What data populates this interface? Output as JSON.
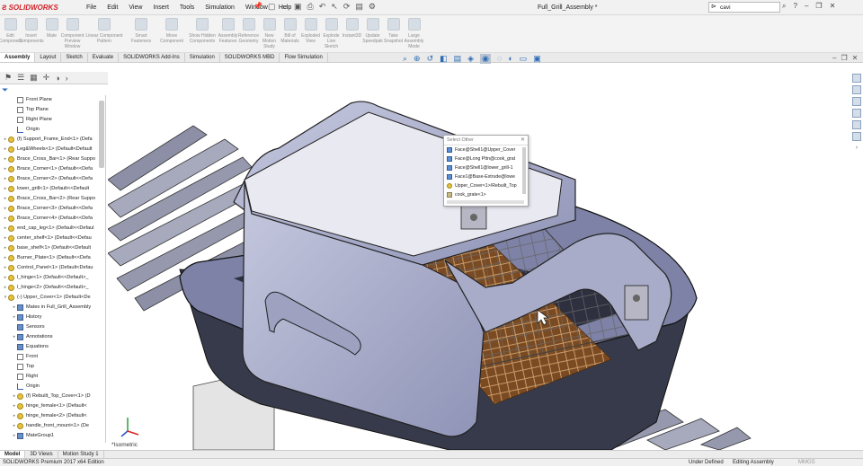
{
  "app": {
    "logo_text": "SOLIDWORKS",
    "document_title": "Full_Grill_Assembly *"
  },
  "menus": [
    "File",
    "Edit",
    "View",
    "Insert",
    "Tools",
    "Simulation",
    "Window",
    "Help"
  ],
  "search": {
    "value": "cavi"
  },
  "commands": [
    {
      "label": "Edit Component",
      "size": "normal"
    },
    {
      "label": "Insert Components",
      "size": "normal"
    },
    {
      "label": "Mate",
      "size": "normal"
    },
    {
      "label": "Component Preview Window",
      "size": "normal"
    },
    {
      "label": "Linear Component Pattern",
      "size": "wide"
    },
    {
      "label": "Smart Fasteners",
      "size": "med"
    },
    {
      "label": "Move Component",
      "size": "med"
    },
    {
      "label": "Show Hidden Components",
      "size": "med"
    },
    {
      "label": "Assembly Features",
      "size": "normal"
    },
    {
      "label": "Reference Geometry",
      "size": "normal"
    },
    {
      "label": "New Motion Study",
      "size": "normal"
    },
    {
      "label": "Bill of Materials",
      "size": "normal"
    },
    {
      "label": "Exploded View",
      "size": "normal"
    },
    {
      "label": "Explode Line Sketch",
      "size": "normal"
    },
    {
      "label": "Instant3D",
      "size": "normal"
    },
    {
      "label": "Update Speedpak",
      "size": "normal"
    },
    {
      "label": "Take Snapshot",
      "size": "normal"
    },
    {
      "label": "Large Assembly Mode",
      "size": "normal"
    }
  ],
  "tabs": [
    {
      "label": "Assembly",
      "active": true
    },
    {
      "label": "Layout",
      "active": false
    },
    {
      "label": "Sketch",
      "active": false
    },
    {
      "label": "Evaluate",
      "active": false
    },
    {
      "label": "SOLIDWORKS Add-Ins",
      "active": false
    },
    {
      "label": "Simulation",
      "active": false
    },
    {
      "label": "SOLIDWORKS MBD",
      "active": false
    },
    {
      "label": "Flow Simulation",
      "active": false
    }
  ],
  "tree": [
    {
      "label": "Front Plane",
      "icon": "plane",
      "indent": 1,
      "arrow": ""
    },
    {
      "label": "Top Plane",
      "icon": "plane",
      "indent": 1,
      "arrow": ""
    },
    {
      "label": "Right Plane",
      "icon": "plane",
      "indent": 1,
      "arrow": ""
    },
    {
      "label": "Origin",
      "icon": "origin",
      "indent": 1,
      "arrow": ""
    },
    {
      "label": "(f) Support_Frame_End<1> (Defa",
      "icon": "part",
      "indent": 0,
      "arrow": "▸"
    },
    {
      "label": "Leg&Wheels<1> (Default<Default",
      "icon": "part",
      "indent": 0,
      "arrow": "▸"
    },
    {
      "label": "Brace_Cross_Bar<1> (Rear Suppo",
      "icon": "part",
      "indent": 0,
      "arrow": "▸"
    },
    {
      "label": "Brace_Corner<1> (Default<<Defa",
      "icon": "part",
      "indent": 0,
      "arrow": "▸"
    },
    {
      "label": "Brace_Corner<2> (Default<<Defa",
      "icon": "part",
      "indent": 0,
      "arrow": "▸"
    },
    {
      "label": "lower_grill<1> (Default<<Default",
      "icon": "part",
      "indent": 0,
      "arrow": "▸"
    },
    {
      "label": "Brace_Cross_Bar<2> (Rear Suppo",
      "icon": "part",
      "indent": 0,
      "arrow": "▸"
    },
    {
      "label": "Brace_Corner<3> (Default<<Defa",
      "icon": "part",
      "indent": 0,
      "arrow": "▸"
    },
    {
      "label": "Brace_Corner<4> (Default<<Defa",
      "icon": "part",
      "indent": 0,
      "arrow": "▸"
    },
    {
      "label": "end_cap_leg<1> (Default<<Defaul",
      "icon": "part",
      "indent": 0,
      "arrow": "▸"
    },
    {
      "label": "center_shelf<1> (Default<<Defau",
      "icon": "part",
      "indent": 0,
      "arrow": "▸"
    },
    {
      "label": "base_shelf<1> (Default<<Default",
      "icon": "part",
      "indent": 0,
      "arrow": "▸"
    },
    {
      "label": "Burner_Plate<1> (Default<<Defa",
      "icon": "part",
      "indent": 0,
      "arrow": "▸"
    },
    {
      "label": "Control_Panel<1> (Default<Defau",
      "icon": "part",
      "indent": 0,
      "arrow": "▸"
    },
    {
      "label": "l_hinge<1> (Default<<Default>_",
      "icon": "part",
      "indent": 0,
      "arrow": "▸"
    },
    {
      "label": "l_hinge<2> (Default<<Default>_",
      "icon": "part",
      "indent": 0,
      "arrow": "▸"
    },
    {
      "label": "(-) Upper_Cover<1> (Default<De",
      "icon": "part",
      "indent": 0,
      "arrow": "▾"
    },
    {
      "label": "Mates in Full_Grill_Assembly",
      "icon": "folder",
      "indent": 1,
      "arrow": "▸"
    },
    {
      "label": "History",
      "icon": "folder",
      "indent": 1,
      "arrow": "▸"
    },
    {
      "label": "Sensors",
      "icon": "folder",
      "indent": 1,
      "arrow": ""
    },
    {
      "label": "Annotations",
      "icon": "folder",
      "indent": 1,
      "arrow": "▸"
    },
    {
      "label": "Equations",
      "icon": "folder",
      "indent": 1,
      "arrow": ""
    },
    {
      "label": "Front",
      "icon": "plane",
      "indent": 1,
      "arrow": ""
    },
    {
      "label": "Top",
      "icon": "plane",
      "indent": 1,
      "arrow": ""
    },
    {
      "label": "Right",
      "icon": "plane",
      "indent": 1,
      "arrow": ""
    },
    {
      "label": "Origin",
      "icon": "origin",
      "indent": 1,
      "arrow": ""
    },
    {
      "label": "(f) Rebuilt_Top_Cover<1> (D",
      "icon": "part",
      "indent": 1,
      "arrow": "▸"
    },
    {
      "label": "hinge_female<1> (Default<",
      "icon": "part",
      "indent": 1,
      "arrow": "▸"
    },
    {
      "label": "hinge_female<2> (Default<",
      "icon": "part",
      "indent": 1,
      "arrow": "▸"
    },
    {
      "label": "handle_front_mount<1> (De",
      "icon": "part",
      "indent": 1,
      "arrow": "▸"
    },
    {
      "label": "MateGroup1",
      "icon": "folder",
      "indent": 1,
      "arrow": "▸"
    }
  ],
  "select_other": {
    "header": "Select Other",
    "items": [
      {
        "label": "Face@Shell1@Upper_Cover",
        "icon": "face"
      },
      {
        "label": "Face@Long Pttn@cook_grat",
        "icon": "face"
      },
      {
        "label": "Face@Shell1@lower_grill-1",
        "icon": "face"
      },
      {
        "label": "Face1@Base-Extrude@lowe",
        "icon": "face"
      },
      {
        "label": "Upper_Cover<1>/Rebuilt_Top",
        "icon": "part"
      },
      {
        "label": "cook_grate<1>",
        "icon": "grate"
      }
    ]
  },
  "view": {
    "orientation_label": "*Isometric"
  },
  "bottom_tabs": [
    {
      "label": "Model",
      "active": true
    },
    {
      "label": "3D Views",
      "active": false
    },
    {
      "label": "Motion Study 1",
      "active": false
    }
  ],
  "status": {
    "edition": "SOLIDWORKS Premium 2017 x64 Edition",
    "definition": "Under Defined",
    "mode": "Editing Assembly",
    "units": "MMGS"
  }
}
